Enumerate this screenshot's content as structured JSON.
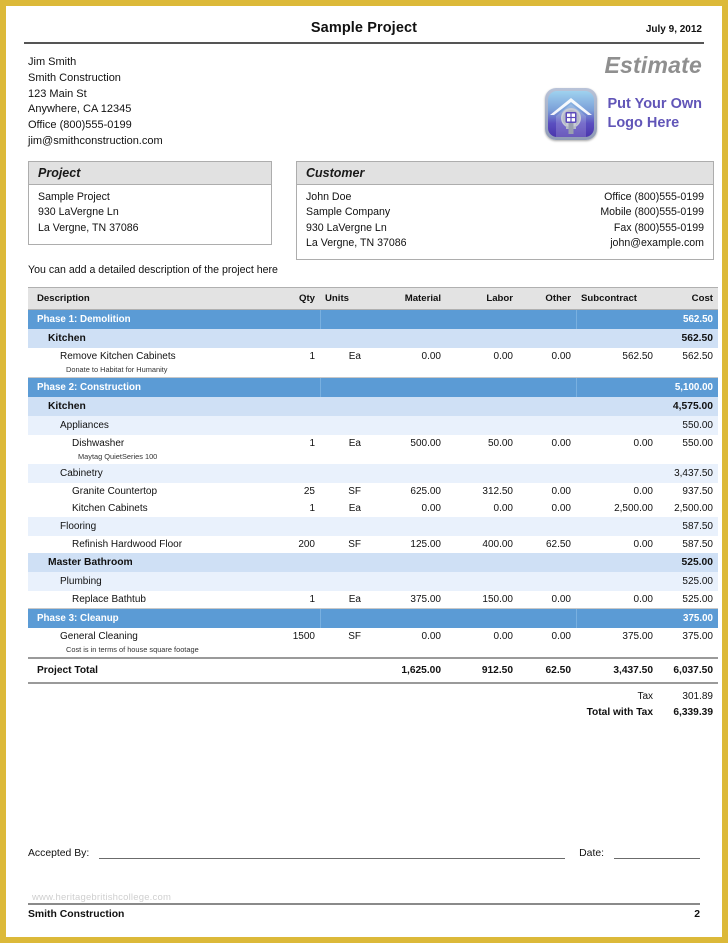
{
  "document": {
    "title": "Sample Project",
    "date": "July 9, 2012",
    "type_label": "Estimate",
    "logo_line1": "Put Your Own",
    "logo_line2": "Logo Here",
    "logo_icon": "house-logo-icon"
  },
  "from": {
    "name": "Jim Smith",
    "company": "Smith Construction",
    "street": "123 Main St",
    "city_state_zip": "Anywhere, CA 12345",
    "office": "Office  (800)555-0199",
    "email": "jim@smithconstruction.com"
  },
  "project_box": {
    "heading": "Project",
    "line1": "Sample Project",
    "line2": "930 LaVergne Ln",
    "line3": "La Vergne, TN 37086"
  },
  "customer_box": {
    "heading": "Customer",
    "rows": [
      {
        "left": "John Doe",
        "right": "Office (800)555-0199"
      },
      {
        "left": "Sample Company",
        "right": "Mobile (800)555-0199"
      },
      {
        "left": "930 LaVergne Ln",
        "right": "Fax (800)555-0199"
      },
      {
        "left": "La Vergne, TN 37086",
        "right": "john@example.com"
      }
    ]
  },
  "description_note": "You can add a detailed description of the project here",
  "table": {
    "columns": [
      "Description",
      "Qty",
      "Units",
      "Material",
      "Labor",
      "Other",
      "Subcontract",
      "Cost"
    ],
    "rows": [
      {
        "kind": "phase",
        "desc": "Phase 1: Demolition",
        "qty": "",
        "units": "",
        "material": "",
        "labor": "",
        "other": "",
        "subcontract": "",
        "cost": "562.50"
      },
      {
        "kind": "area",
        "desc": "Kitchen",
        "qty": "",
        "units": "",
        "material": "",
        "labor": "",
        "other": "",
        "subcontract": "",
        "cost": "562.50"
      },
      {
        "kind": "item2",
        "desc": "Remove Kitchen Cabinets",
        "qty": "1",
        "units": "Ea",
        "material": "0.00",
        "labor": "0.00",
        "other": "0.00",
        "subcontract": "562.50",
        "cost": "562.50"
      },
      {
        "kind": "note2",
        "desc": "Donate to Habitat for Humanity",
        "qty": "",
        "units": "",
        "material": "",
        "labor": "",
        "other": "",
        "subcontract": "",
        "cost": ""
      },
      {
        "kind": "rule"
      },
      {
        "kind": "phase",
        "desc": "Phase 2: Construction",
        "qty": "",
        "units": "",
        "material": "",
        "labor": "",
        "other": "",
        "subcontract": "",
        "cost": "5,100.00"
      },
      {
        "kind": "area",
        "desc": "Kitchen",
        "qty": "",
        "units": "",
        "material": "",
        "labor": "",
        "other": "",
        "subcontract": "",
        "cost": "4,575.00"
      },
      {
        "kind": "group",
        "desc": "Appliances",
        "qty": "",
        "units": "",
        "material": "",
        "labor": "",
        "other": "",
        "subcontract": "",
        "cost": "550.00"
      },
      {
        "kind": "item",
        "desc": "Dishwasher",
        "qty": "1",
        "units": "Ea",
        "material": "500.00",
        "labor": "50.00",
        "other": "0.00",
        "subcontract": "0.00",
        "cost": "550.00"
      },
      {
        "kind": "note",
        "desc": "Maytag QuietSeries 100",
        "qty": "",
        "units": "",
        "material": "",
        "labor": "",
        "other": "",
        "subcontract": "",
        "cost": ""
      },
      {
        "kind": "group",
        "desc": "Cabinetry",
        "qty": "",
        "units": "",
        "material": "",
        "labor": "",
        "other": "",
        "subcontract": "",
        "cost": "3,437.50"
      },
      {
        "kind": "item",
        "desc": "Granite Countertop",
        "qty": "25",
        "units": "SF",
        "material": "625.00",
        "labor": "312.50",
        "other": "0.00",
        "subcontract": "0.00",
        "cost": "937.50"
      },
      {
        "kind": "item",
        "desc": "Kitchen Cabinets",
        "qty": "1",
        "units": "Ea",
        "material": "0.00",
        "labor": "0.00",
        "other": "0.00",
        "subcontract": "2,500.00",
        "cost": "2,500.00"
      },
      {
        "kind": "group",
        "desc": "Flooring",
        "qty": "",
        "units": "",
        "material": "",
        "labor": "",
        "other": "",
        "subcontract": "",
        "cost": "587.50"
      },
      {
        "kind": "item",
        "desc": "Refinish Hardwood Floor",
        "qty": "200",
        "units": "SF",
        "material": "125.00",
        "labor": "400.00",
        "other": "62.50",
        "subcontract": "0.00",
        "cost": "587.50"
      },
      {
        "kind": "area",
        "desc": "Master Bathroom",
        "qty": "",
        "units": "",
        "material": "",
        "labor": "",
        "other": "",
        "subcontract": "",
        "cost": "525.00"
      },
      {
        "kind": "group",
        "desc": "Plumbing",
        "qty": "",
        "units": "",
        "material": "",
        "labor": "",
        "other": "",
        "subcontract": "",
        "cost": "525.00"
      },
      {
        "kind": "item",
        "desc": "Replace Bathtub",
        "qty": "1",
        "units": "Ea",
        "material": "375.00",
        "labor": "150.00",
        "other": "0.00",
        "subcontract": "0.00",
        "cost": "525.00"
      },
      {
        "kind": "rule"
      },
      {
        "kind": "phase",
        "desc": "Phase 3: Cleanup",
        "qty": "",
        "units": "",
        "material": "",
        "labor": "",
        "other": "",
        "subcontract": "",
        "cost": "375.00"
      },
      {
        "kind": "item2",
        "desc": "General Cleaning",
        "qty": "1500",
        "units": "SF",
        "material": "0.00",
        "labor": "0.00",
        "other": "0.00",
        "subcontract": "375.00",
        "cost": "375.00"
      },
      {
        "kind": "note2",
        "desc": "Cost is in terms of house square footage",
        "qty": "",
        "units": "",
        "material": "",
        "labor": "",
        "other": "",
        "subcontract": "",
        "cost": ""
      }
    ],
    "totals": {
      "project_total_label": "Project Total",
      "material": "1,625.00",
      "labor": "912.50",
      "other": "62.50",
      "subcontract": "3,437.50",
      "cost": "6,037.50",
      "tax_label": "Tax",
      "tax_value": "301.89",
      "total_with_tax_label": "Total with Tax",
      "total_with_tax_value": "6,339.39"
    }
  },
  "signature": {
    "accepted_by_label": "Accepted By:",
    "date_label": "Date:"
  },
  "footer": {
    "watermark": "www.heritagebritishcollege.com",
    "company": "Smith Construction",
    "page_number": "2"
  },
  "colors": {
    "page_border": "#dcb939",
    "phase_blue": "#5b9bd5",
    "area_blue": "#cfe0f5",
    "group_blue": "#e9f1fc",
    "table_header_gray": "#e3e3e3",
    "box_header_gray": "#e1e1e1",
    "logo_purple": "#6155b8",
    "estimate_gray": "#8f8f8f"
  }
}
